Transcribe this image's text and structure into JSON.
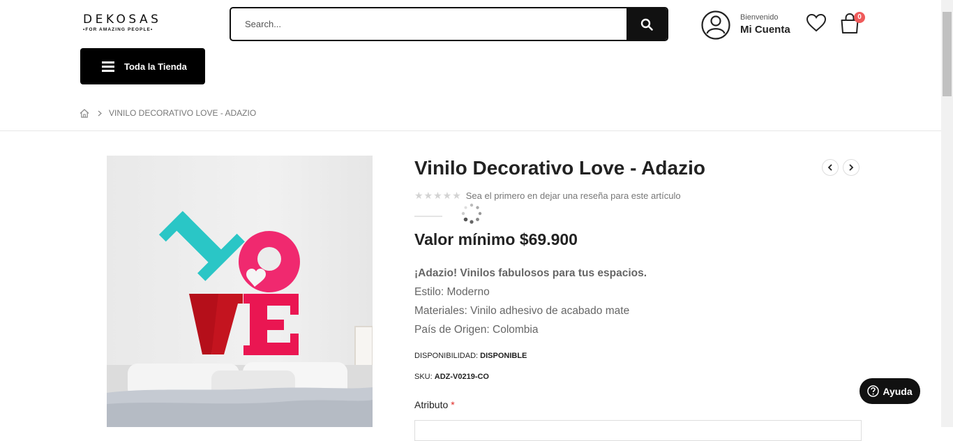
{
  "header": {
    "logo_text": "DEKOSAS",
    "logo_tagline": "•FOR AMAZING PEOPLE•",
    "search_placeholder": "Search...",
    "account_welcome": "Bienvenido",
    "account_label": "Mi Cuenta",
    "cart_count": "0",
    "store_menu_label": "Toda la Tienda"
  },
  "breadcrumb": {
    "current": "VINILO DECORATIVO LOVE - ADAZIO"
  },
  "product": {
    "title": "Vinilo Decorativo Love - Adazio",
    "rating_stars": "★★★★★",
    "review_prompt": "Sea el primero en dejar una reseña para este artículo",
    "price": "Valor mínimo $69.900",
    "description": {
      "tagline": "¡Adazio! Vinilos fabulosos para tus espacios.",
      "style": "Estilo: Moderno",
      "materials": "Materiales: Vinilo adhesivo de acabado mate",
      "origin": "País de Origen: Colombia"
    },
    "availability_label": "DISPONIBILIDAD:",
    "availability_value": "DISPONIBLE",
    "sku_label": "SKU:",
    "sku_value": "ADZ-V0219-CO",
    "attribute_label": "Atributo",
    "required_mark": "*",
    "image_text": [
      "L",
      "O",
      "V",
      "E"
    ]
  },
  "help": {
    "label": "Ayuda"
  },
  "colors": {
    "brand_black": "#111111",
    "badge_red": "#ef5a5a",
    "love_teal": "#2ac6c6",
    "love_pink": "#f0296f",
    "love_dark_red": "#c4141f"
  }
}
